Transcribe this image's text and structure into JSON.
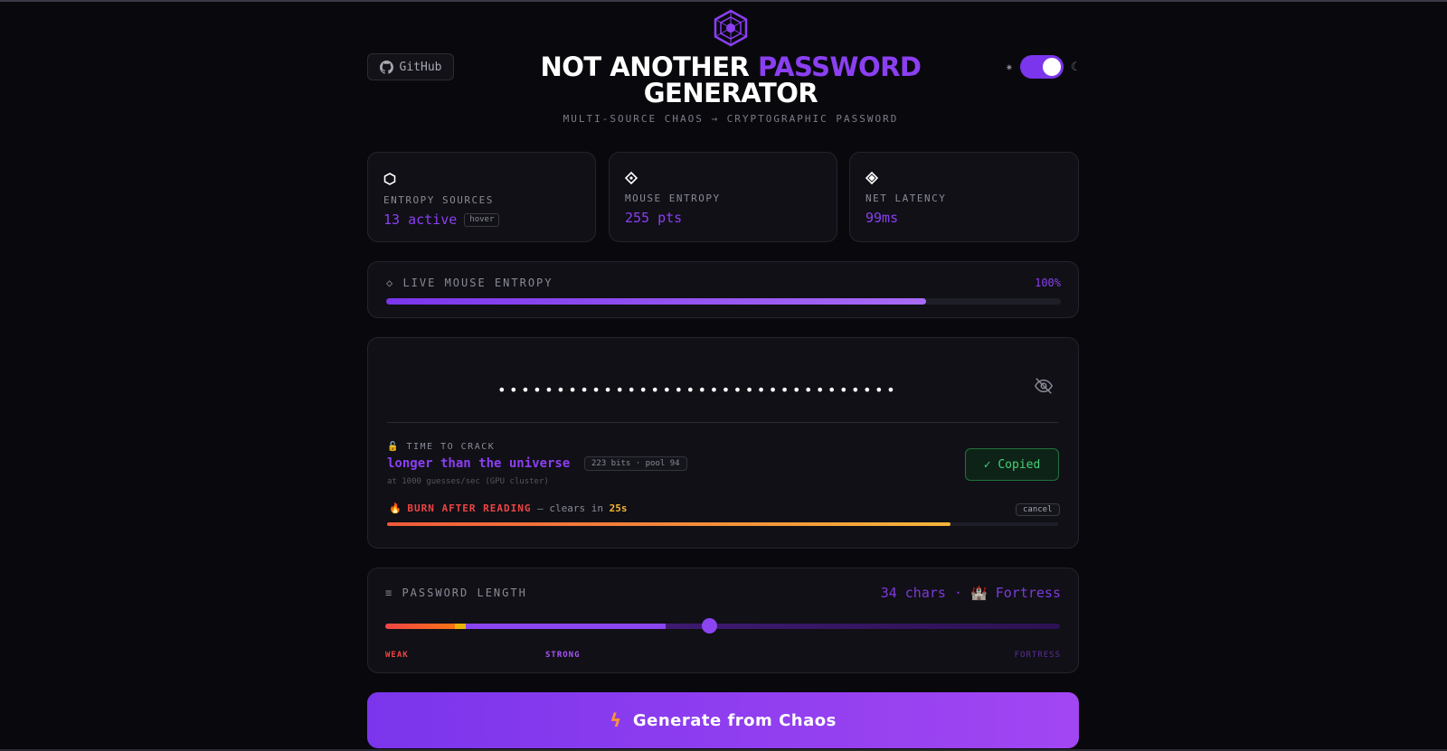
{
  "header": {
    "github_label": "GitHub",
    "title_part1": "NOT ANOTHER ",
    "title_accent": "PASSWORD",
    "title_part2": "GENERATOR",
    "subtitle": "MULTI-SOURCE CHAOS → CRYPTOGRAPHIC PASSWORD",
    "theme_toggle_on": true
  },
  "stats": {
    "entropy_sources": {
      "label": "ENTROPY SOURCES",
      "value": "13 active",
      "badge": "hover"
    },
    "mouse_entropy": {
      "label": "MOUSE ENTROPY",
      "value": "255 pts"
    },
    "net_latency": {
      "label": "NET LATENCY",
      "value": "99ms"
    }
  },
  "live_entropy": {
    "label": "LIVE MOUSE ENTROPY",
    "percent_label": "100%",
    "fill_fraction": 0.8
  },
  "password": {
    "masked": "••••••••••••••••••••••••••••••••••",
    "time_to_crack_label": "TIME TO CRACK",
    "time_to_crack_value": "longer than the universe",
    "bits_badge": "223 bits · pool 94",
    "note": "at 1000 guesses/sec (GPU cluster)",
    "copied_label": "✓ Copied",
    "burn_title": "BURN AFTER READING",
    "burn_text": " — clears in ",
    "burn_time": "25s",
    "cancel_label": "cancel",
    "burn_fraction": 0.84
  },
  "length": {
    "label": "PASSWORD LENGTH",
    "chars_text": "34 chars",
    "separator": " · ",
    "level_text": "Fortress",
    "slider_fraction": 0.48,
    "ticks": {
      "weak": "WEAK",
      "strong": "STRONG",
      "fortress": "FORTRESS"
    }
  },
  "generate": {
    "label": "Generate from Chaos"
  },
  "colors": {
    "accent": "#8b3ff2",
    "success": "#48d07a",
    "danger": "#ef4444",
    "warning": "#f5b53a"
  }
}
